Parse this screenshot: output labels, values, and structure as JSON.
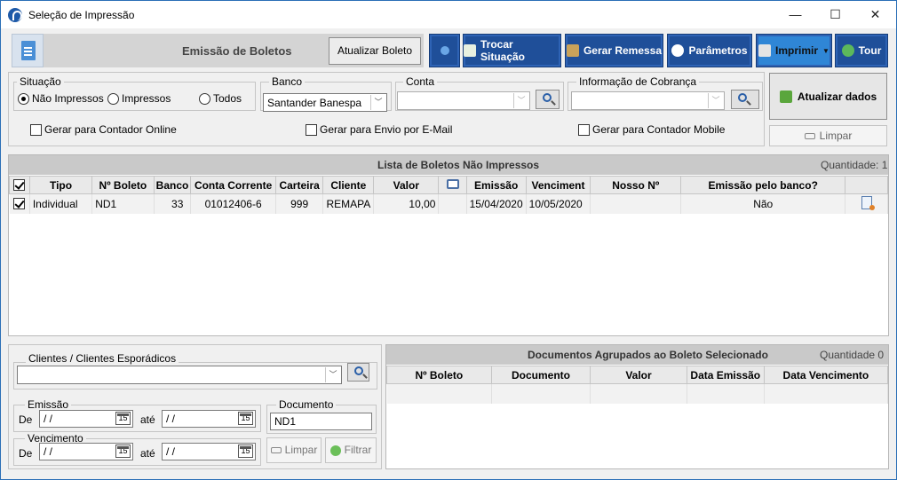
{
  "window": {
    "title": "Seleção de Impressão",
    "min": "—",
    "max": "☐",
    "close": "✕"
  },
  "toolbar": {
    "title": "Emissão de Boletos",
    "atualizar_boleto": "Atualizar Boleto",
    "trocar": "Trocar Situação",
    "remessa": "Gerar Remessa",
    "parametros": "Parâmetros",
    "imprimir": "Imprimir",
    "tour": "Tour"
  },
  "filters": {
    "situacao": {
      "label": "Situação",
      "nao": "Não Impressos",
      "imp": "Impressos",
      "todos": "Todos",
      "selected": "Não Impressos"
    },
    "banco": {
      "label": "Banco",
      "value": "Santander Banespa"
    },
    "conta": {
      "label": "Conta",
      "value": ""
    },
    "info": {
      "label": "Informação de Cobrança",
      "value": ""
    },
    "chk_online": "Gerar para Contador Online",
    "chk_email": "Gerar para Envio por E-Mail",
    "chk_mobile": "Gerar para Contador Mobile",
    "atualizar_dados": "Atualizar dados",
    "limpar": "Limpar"
  },
  "lista": {
    "title": "Lista de Boletos Não Impressos",
    "quantidade": "Quantidade: 1",
    "columns": [
      "Tipo",
      "Nº Boleto",
      "Banco",
      "Conta Corrente",
      "Carteira",
      "Cliente",
      "Valor",
      "Emissão",
      "Venciment",
      "Nosso Nº",
      "Emissão pelo banco?"
    ],
    "rows": [
      {
        "tipo": "Individual",
        "boleto": "ND1",
        "banco": "33",
        "conta": "01012406-6",
        "carteira": "999",
        "cliente": "REMAPA",
        "valor": "10,00",
        "emissao": "15/04/2020",
        "venc": "10/05/2020",
        "nosso": "",
        "emissao_banco": "Não"
      }
    ]
  },
  "bottom": {
    "clientes_label": "Clientes / Clientes Esporádicos",
    "emissao_label": "Emissão",
    "vencimento_label": "Vencimento",
    "de": "De",
    "ate": "até",
    "date_ph": " /  /",
    "documento_label": "Documento",
    "documento_value": "ND1",
    "limpar": "Limpar",
    "filtrar": "Filtrar"
  },
  "docs": {
    "title": "Documentos Agrupados ao Boleto Selecionado",
    "quantidade": "Quantidade 0",
    "columns": [
      "Nº Boleto",
      "Documento",
      "Valor",
      "Data Emissão",
      "Data Vencimento"
    ]
  }
}
